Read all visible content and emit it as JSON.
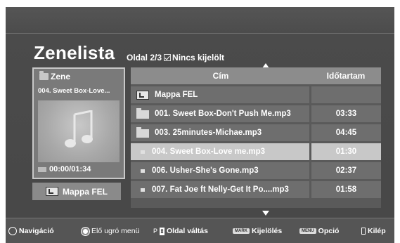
{
  "header": {
    "title": "Zenelista",
    "page_info": "Oldal 2/3",
    "selection_info": "Nincs kijelölt"
  },
  "left_panel": {
    "folder_label": "Zene",
    "track_label": "004. Sweet Box-Love...",
    "time": "00:00/01:34",
    "up_button_label": "Mappa FEL"
  },
  "list": {
    "columns": [
      "Cím",
      "Időtartam"
    ],
    "rows": [
      {
        "type": "up",
        "name": "Mappa FEL",
        "duration": ""
      },
      {
        "type": "folder",
        "name": "001. Sweet Box-Don't Push Me.mp3",
        "duration": "03:33"
      },
      {
        "type": "folder",
        "name": "003. 25minutes-Michae.mp3",
        "duration": "04:45"
      },
      {
        "type": "file",
        "name": "004. Sweet Box-Love me.mp3",
        "duration": "01:30",
        "selected": true
      },
      {
        "type": "file",
        "name": "006. Usher-She's Gone.mp3",
        "duration": "02:37"
      },
      {
        "type": "file",
        "name": "007. Fat Joe ft Nelly-Get It Po....mp3",
        "duration": "01:58"
      }
    ]
  },
  "footer": {
    "navigation": "Navigáció",
    "preview": "Elő",
    "jump_menu": "ugró menü",
    "page_key": "P",
    "page_change": "Oldal váltás",
    "mark_key": "MARK",
    "mark_label": "Kijelölés",
    "menu_key": "MENU",
    "option_label": "Opció",
    "exit_label": "Kilép"
  },
  "colors": {
    "background": "#474747",
    "list_row": "#6e6e6e",
    "header_bar": "#8c8c8c",
    "selected_row": "#c8c8c8"
  }
}
